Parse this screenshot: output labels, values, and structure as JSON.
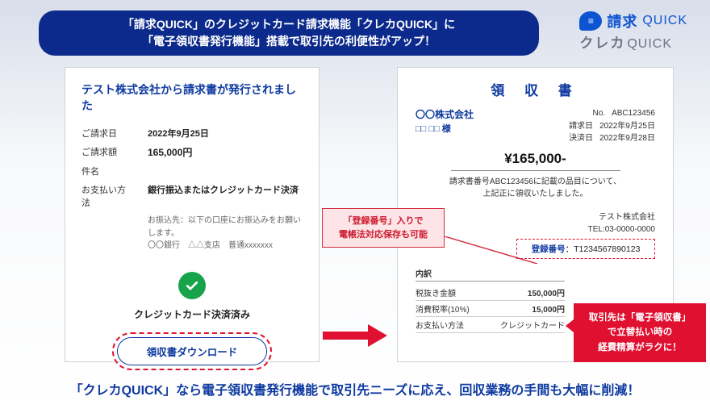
{
  "header": {
    "line1": "「請求QUICK」のクレジットカード請求機能「クレカQUICK」に",
    "line2": "「電子領収書発行機能」搭載で取引先の利便性がアップ！"
  },
  "logo": {
    "seikyu": "請求",
    "quick1": "QUICK",
    "kureka": "クレカ",
    "quick2": "QUICK"
  },
  "left": {
    "title": "テスト株式会社から請求書が発行されました",
    "rows": {
      "bill_date_label": "ご請求日",
      "bill_date": "2022年9月25日",
      "bill_amount_label": "ご請求額",
      "bill_amount": "165,000円",
      "subject_label": "件名",
      "method_label": "お支払い方法",
      "method": "銀行振込またはクレジットカード決済",
      "note1": "お振込先：以下の口座にお振込みをお願いします。",
      "note2": "〇〇銀行　△△支店　普通xxxxxxx"
    },
    "paid_label": "クレジットカード決済済み",
    "dl_button": "領収書ダウンロード"
  },
  "callout_pink": {
    "line1a": "「",
    "line1b": "登録番号",
    "line1c": "」入りで",
    "line2": "電帳法対応保存も可能"
  },
  "receipt": {
    "title": "領 収 書",
    "addressee_company": "〇〇株式会社",
    "addressee_person": "□□ □□ 様",
    "number_label": "No.",
    "number": "ABC123456",
    "bill_date_label": "請求日",
    "bill_date": "2022年9月25日",
    "pay_date_label": "決済日",
    "pay_date": "2022年9月28日",
    "amount": "¥165,000-",
    "memo1": "請求書番号ABC123456に記載の品目について、",
    "memo2": "上記正に領収いたしました。",
    "issuer_company": "テスト株式会社",
    "issuer_tel": "TEL:03-0000-0000",
    "reg_label": "登録番号",
    "reg_value": "：T1234567890123",
    "breakdown_head": "内訳",
    "bd1_label": "税抜き金額",
    "bd1_value": "150,000円",
    "bd2_label": "消費税率(10%)",
    "bd2_value": "15,000円",
    "bd3_label": "お支払い方法",
    "bd3_value": "クレジットカード"
  },
  "callout_red": {
    "line1": "取引先は「電子領収書」",
    "line2": "で立替払い時の",
    "line3": "経費精算がラクに！"
  },
  "bottom": "「クレカQUICK」なら電子領収書発行機能で取引先ニーズに応え、回収業務の手間も大幅に削減！"
}
